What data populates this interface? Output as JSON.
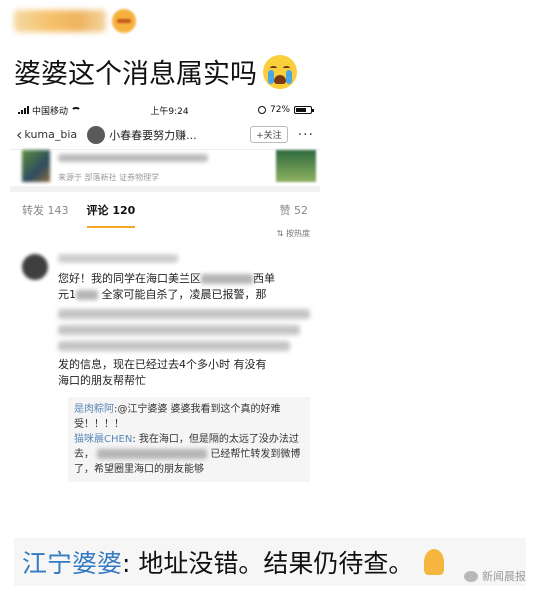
{
  "post": {
    "caption": "婆婆这个消息属实吗"
  },
  "phone": {
    "status": {
      "carrier": "中国移动",
      "time": "上午9:24",
      "battery": "72%"
    },
    "nav": {
      "back_label": "kuma_bia",
      "title": "小春春要努力赚...",
      "follow_label": "+关注",
      "more": "···"
    },
    "card": {
      "source": "来源于 部落新社 证券物理学"
    },
    "tabs": {
      "repost": "转发 143",
      "comment": "评论 120",
      "like": "赞 52"
    },
    "sort_label": "⇅ 按热度",
    "comment": {
      "line1_a": "您好！我的同学在海口美兰区",
      "line1_b": "西单",
      "line2_a": "元1",
      "line2_b": "全家可能自杀了，凌晨已报警，那",
      "line_end1": "发的信息，现在已经过去4个多小时 有没有",
      "line_end2": "海口的朋友帮帮忙"
    },
    "replies": [
      {
        "name": "是肉粽阿",
        "text": ":@江宁婆婆  婆婆我看到这个真的好难受！！！！"
      },
      {
        "name": "猫咪晨CHEN",
        "text": ": 我在海口，但是隔的太远了没办法过去，",
        "tail": "已经帮忙转发到微博了，希望圈里海口的朋友能够"
      }
    ]
  },
  "answer": {
    "name": "江宁婆婆",
    "text": ": 地址没错。结果仍待查。"
  },
  "watermark": "新闻晨报"
}
